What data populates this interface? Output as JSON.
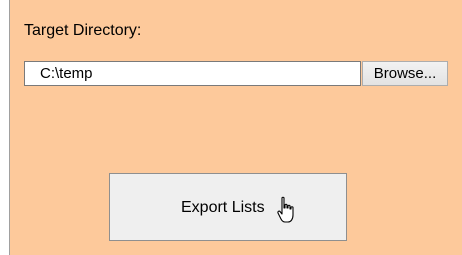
{
  "target_directory": {
    "label": "Target Directory:",
    "value": "C:\\temp",
    "browse_label": "Browse..."
  },
  "export": {
    "label": "Export Lists"
  },
  "cursor": {
    "icon": "hand-pointer-cursor-icon"
  },
  "colors": {
    "panel_background": "#fdc99b",
    "button_face": "#efefef"
  }
}
